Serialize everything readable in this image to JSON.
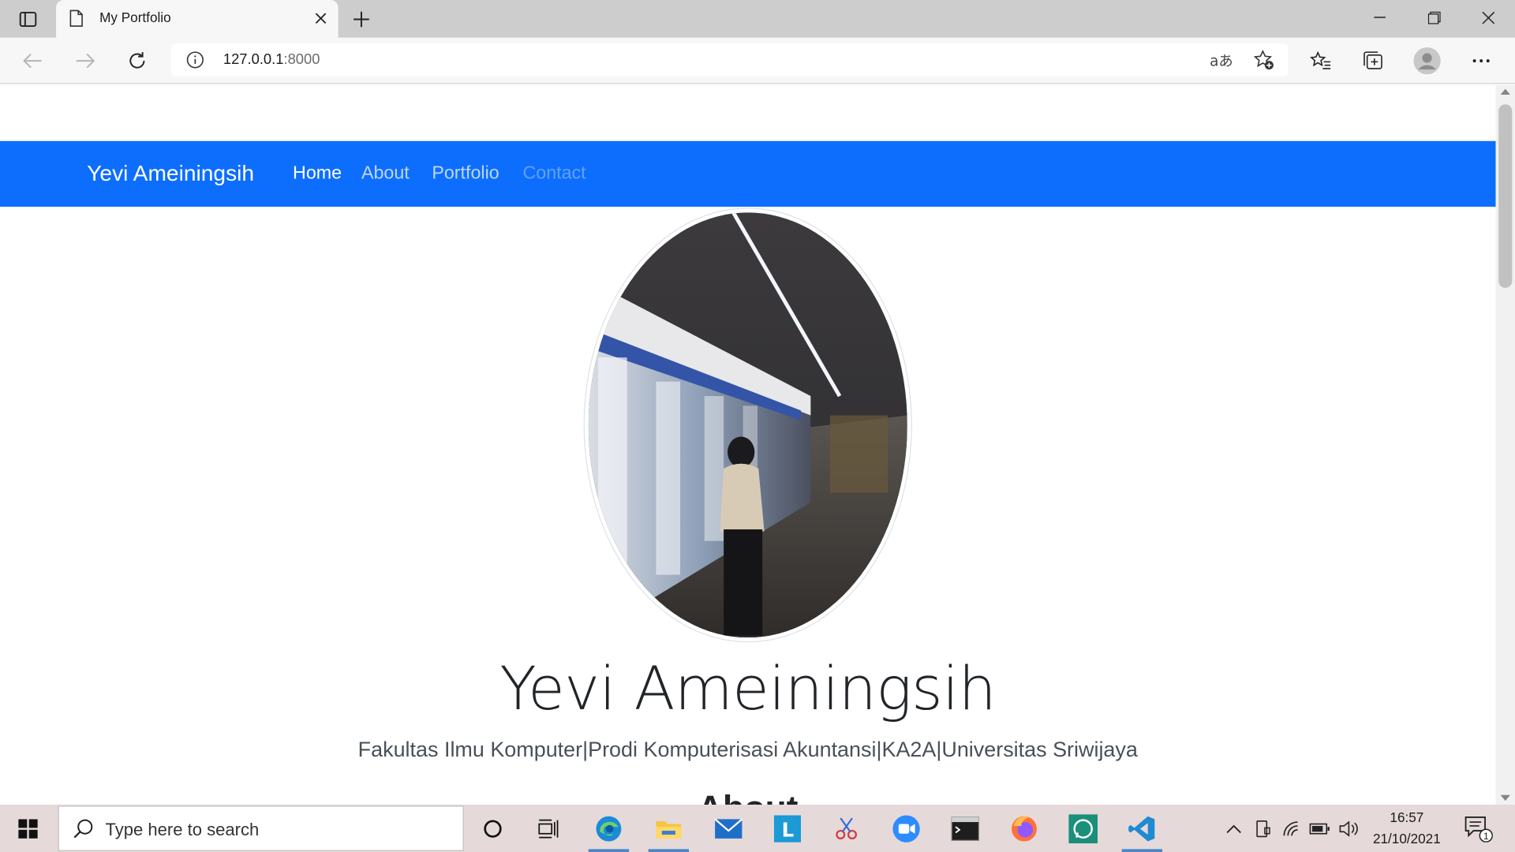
{
  "browser": {
    "tab_title": "My Portfolio",
    "url_host": "127.0.0.1",
    "url_port": ":8000"
  },
  "page": {
    "brand": "Yevi Ameiningsih",
    "nav": [
      {
        "label": "Home"
      },
      {
        "label": "About"
      },
      {
        "label": "Portfolio"
      },
      {
        "label": "Contact"
      }
    ],
    "hero_name": "Yevi Ameiningsih",
    "hero_subtitle": "Fakultas Ilmu Komputer|Prodi Komputerisasi Akuntansi|KA2A|Universitas Sriwijaya",
    "about_heading": "About"
  },
  "taskbar": {
    "search_placeholder": "Type here to search",
    "time": "16:57",
    "date": "21/10/2021",
    "notification_count": "1"
  },
  "colors": {
    "navbar": "#0d6efd",
    "taskbar": "#e6d9d9",
    "tabstrip": "#cdcdcd"
  }
}
